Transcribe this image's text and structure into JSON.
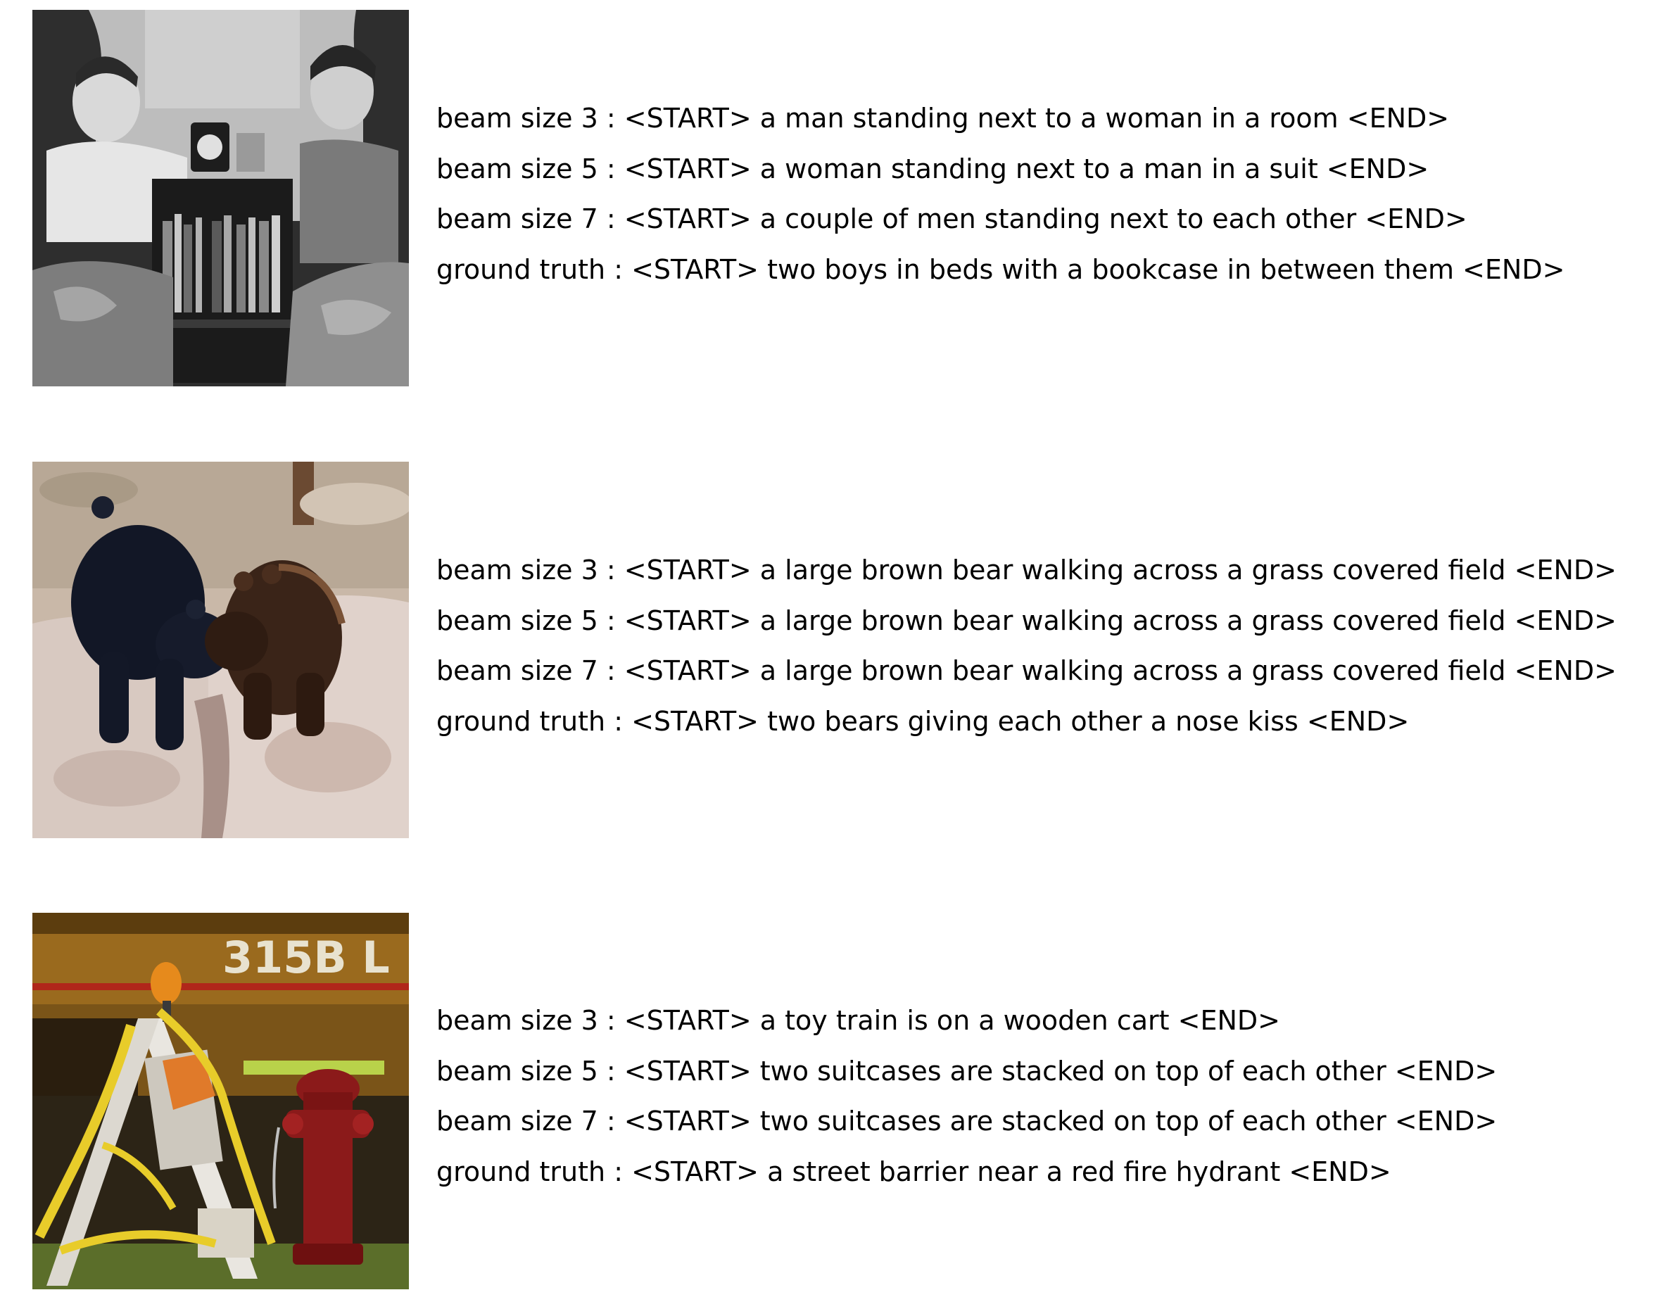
{
  "rows": [
    {
      "image_alt": "photo-two-boys-bookcase",
      "captions": [
        {
          "label": "beam size 3",
          "text": "<START> a man standing next to a woman in a room <END>"
        },
        {
          "label": "beam size 5",
          "text": "<START> a woman standing next to a man in a suit <END>"
        },
        {
          "label": "beam size 7",
          "text": "<START> a couple of men standing next to each other <END>"
        },
        {
          "label": "ground truth",
          "text": "<START> two boys in beds with a bookcase in between them <END>"
        }
      ]
    },
    {
      "image_alt": "photo-two-bears",
      "captions": [
        {
          "label": "beam size 3",
          "text": "<START> a large brown bear walking across a grass covered field <END>"
        },
        {
          "label": "beam size 5",
          "text": "<START> a large brown bear walking across a grass covered field <END>"
        },
        {
          "label": "beam size 7",
          "text": "<START> a large brown bear walking across a grass covered field <END>"
        },
        {
          "label": "ground truth",
          "text": "<START> two bears giving each other a nose kiss <END>"
        }
      ]
    },
    {
      "image_alt": "photo-barrier-hydrant",
      "image_text": "315B L",
      "captions": [
        {
          "label": "beam size 3",
          "text": "<START> a toy train is on a wooden cart <END>"
        },
        {
          "label": "beam size 5",
          "text": "<START> two suitcases are stacked on top of each other <END>"
        },
        {
          "label": "beam size 7",
          "text": "<START> two suitcases are stacked on top of each other <END>"
        },
        {
          "label": "ground truth",
          "text": "<START> a street barrier near a red fire hydrant <END>"
        }
      ]
    }
  ],
  "separator": " : ",
  "colors": {
    "text": "#000000",
    "background": "#ffffff",
    "hydrant_red": "#8b1a1a",
    "tape_yellow": "#e8cc2a",
    "excavator_body": "#9a6a1e"
  }
}
